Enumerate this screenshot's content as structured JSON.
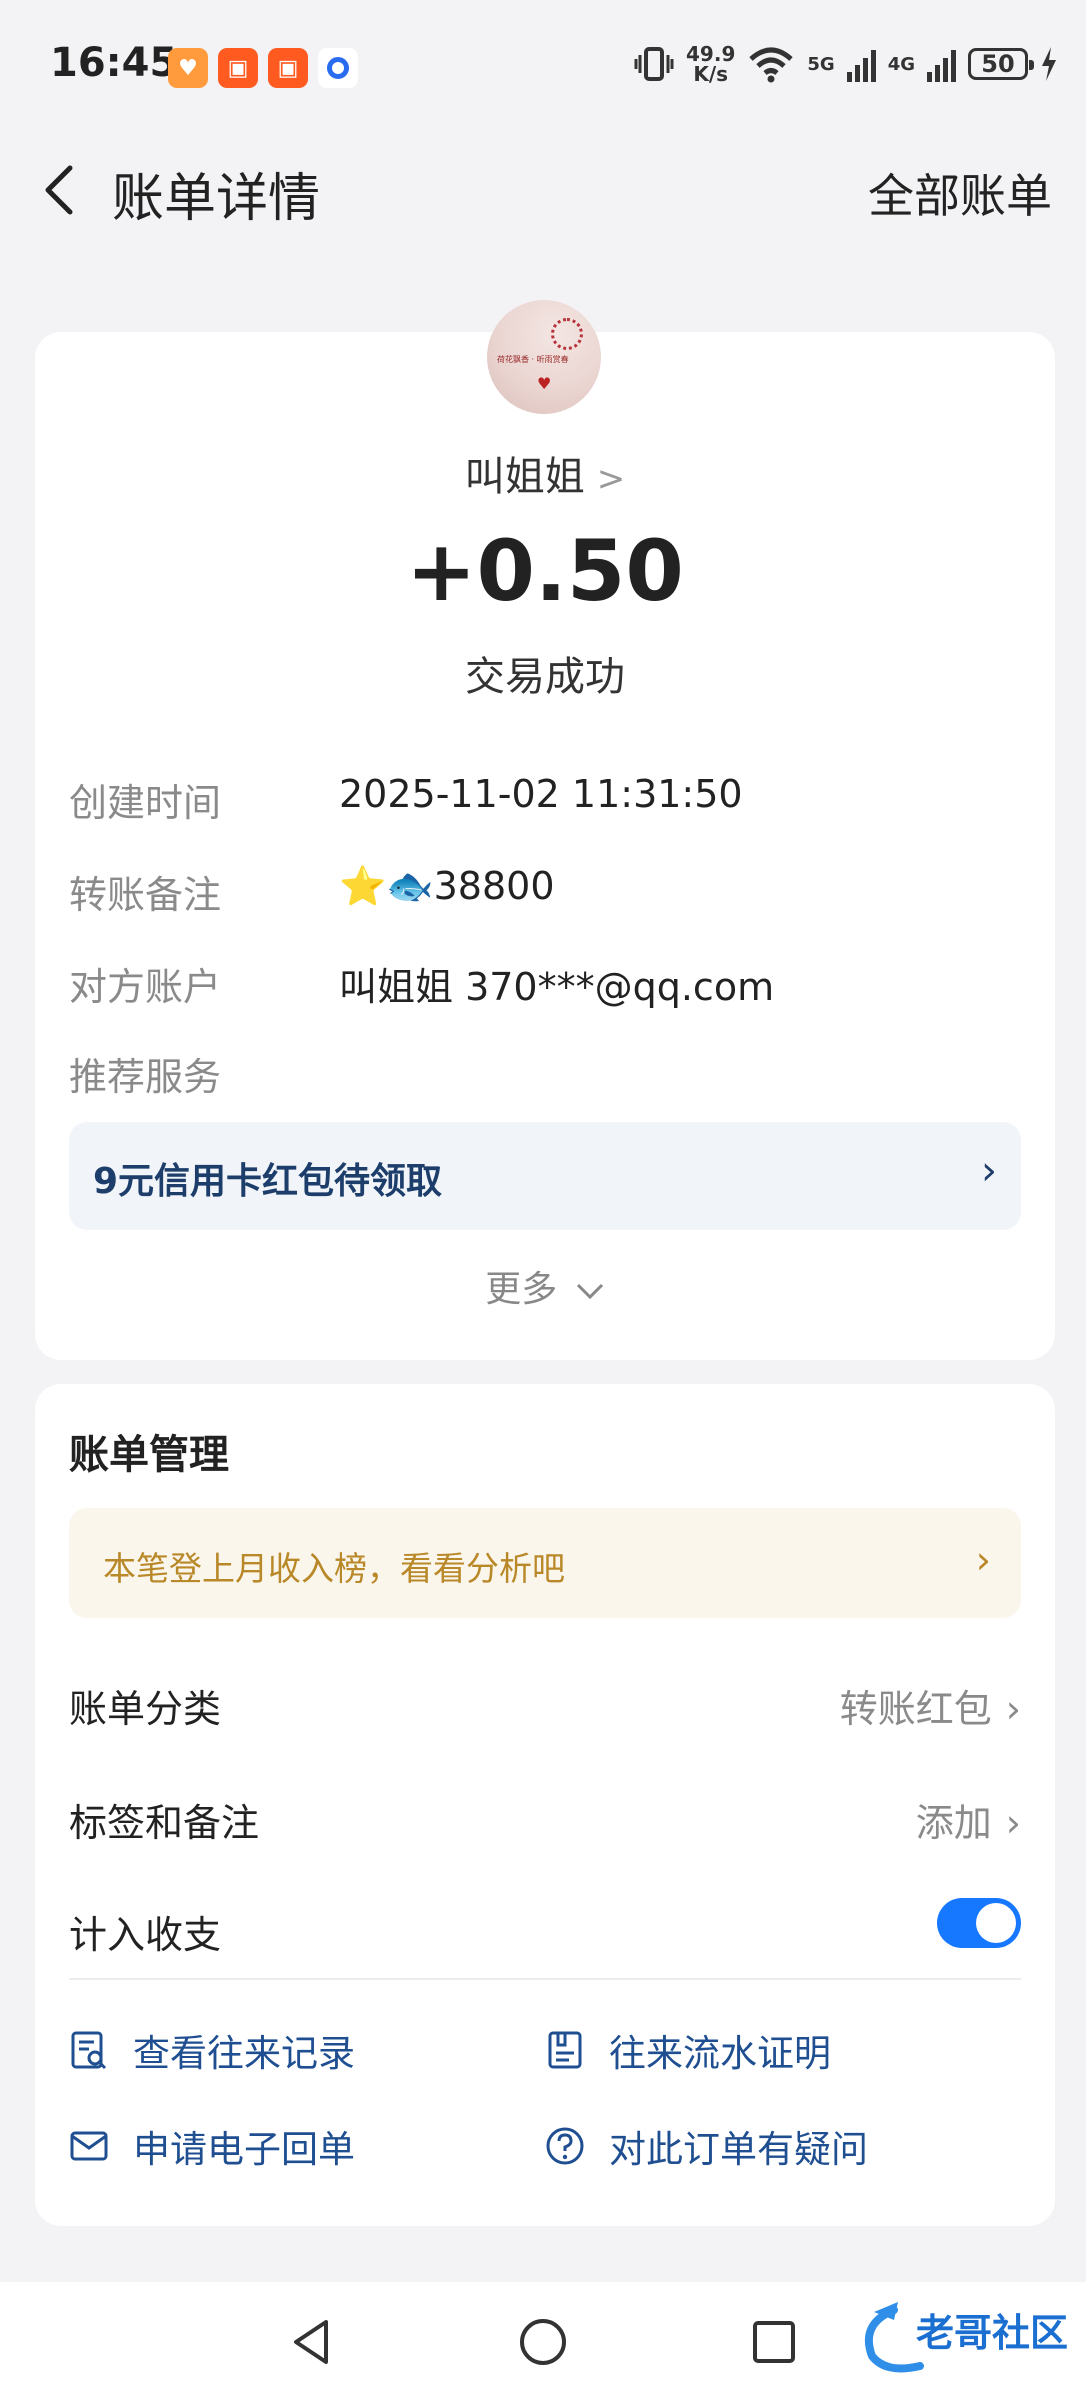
{
  "status_bar": {
    "time": "16:45",
    "net_speed_value": "49.9",
    "net_speed_unit": "K/s",
    "net_5g": "5G",
    "net_4g": "4G",
    "battery": "50",
    "app_icons": [
      "heart-app-icon",
      "app-icon",
      "app-icon",
      "record-icon"
    ]
  },
  "header": {
    "title": "账单详情",
    "right_action": "全部账单"
  },
  "detail": {
    "payee": "叫姐姐",
    "amount": "+0.50",
    "status": "交易成功",
    "rows": [
      {
        "label": "创建时间",
        "value": "2025-11-02 11:31:50"
      },
      {
        "label": "转账备注",
        "value": "⭐🐟38800"
      },
      {
        "label": "对方账户",
        "value": "叫姐姐 370***@qq.com"
      },
      {
        "label": "推荐服务",
        "value": ""
      }
    ],
    "promo": "9元信用卡红包待领取",
    "more": "更多"
  },
  "management": {
    "title": "账单管理",
    "tip": "本笔登上月收入榜，看看分析吧",
    "category_label": "账单分类",
    "category_value": "转账红包",
    "tag_label": "标签和备注",
    "tag_value": "添加",
    "count_label": "计入收支",
    "count_enabled": true,
    "links": [
      "查看往来记录",
      "往来流水证明",
      "申请电子回单",
      "对此订单有疑问"
    ]
  },
  "watermark": "老哥社区",
  "colors": {
    "accent": "#1677ff",
    "link": "#1f4f91",
    "tip_text": "#b98828",
    "background": "#f3f3f5"
  }
}
